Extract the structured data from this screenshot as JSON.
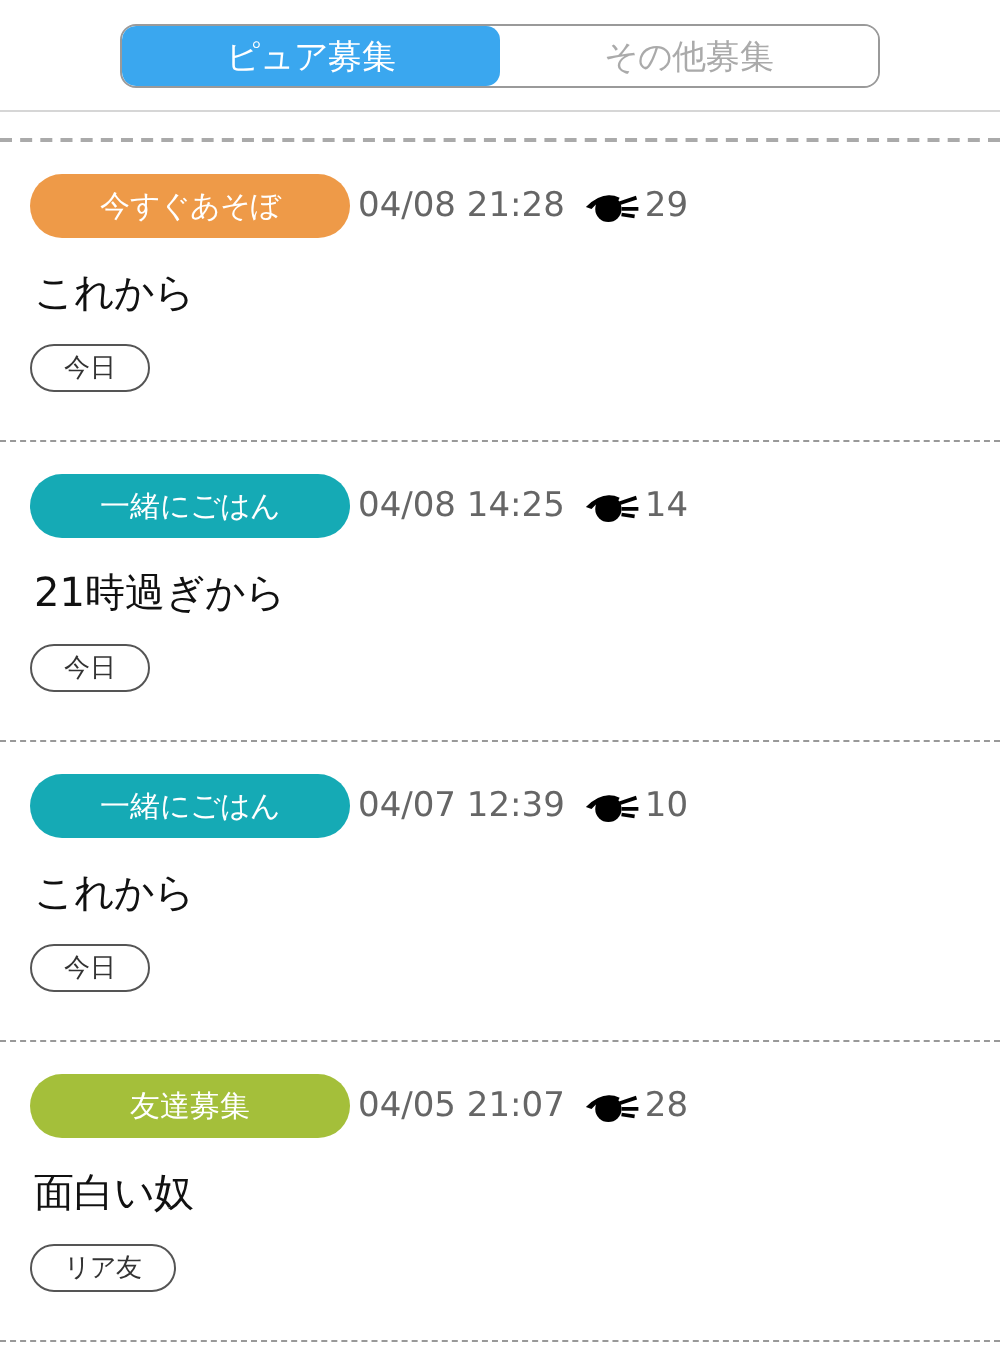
{
  "tabs": [
    {
      "label": "ピュア募集",
      "selected": true
    },
    {
      "label": "その他募集",
      "selected": false
    }
  ],
  "posts": [
    {
      "category": "今すぐあそぼ",
      "color": "#ee9a48",
      "date": "04/08 21:28",
      "views": "29",
      "title": "これから",
      "tag": "今日"
    },
    {
      "category": "一緒にごはん",
      "color": "#15aab5",
      "date": "04/08 14:25",
      "views": "14",
      "title": "21時過ぎから",
      "tag": "今日"
    },
    {
      "category": "一緒にごはん",
      "color": "#15aab5",
      "date": "04/07 12:39",
      "views": "10",
      "title": "これから",
      "tag": "今日"
    },
    {
      "category": "友達募集",
      "color": "#a4bf3a",
      "date": "04/05 21:07",
      "views": "28",
      "title": "面白い奴",
      "tag": "リア友"
    }
  ]
}
